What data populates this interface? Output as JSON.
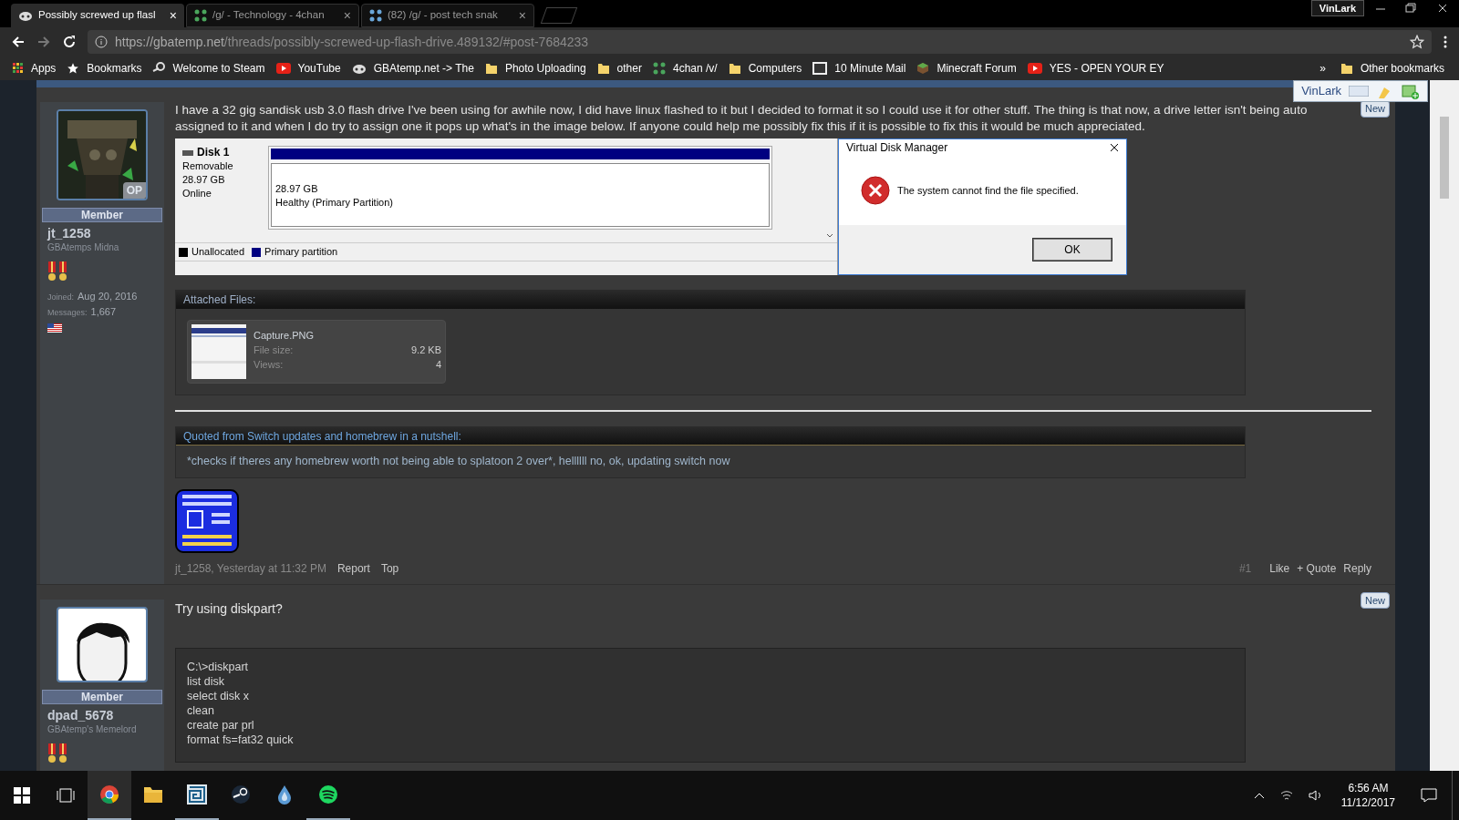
{
  "browser": {
    "tabs": [
      {
        "title": "Possibly screwed up flasl",
        "selected": true,
        "close": "×"
      },
      {
        "title": "/g/ - Technology - 4chan",
        "selected": false,
        "close": "×"
      },
      {
        "title": "(82) /g/ - post tech snak",
        "selected": false,
        "close": "×"
      }
    ],
    "profile": "VinLark",
    "url_host": "https://gbatemp.net",
    "url_path": "/threads/possibly-screwed-up-flash-drive.489132/#post-7684233",
    "bookmarks": [
      {
        "label": "Apps",
        "kind": "apps"
      },
      {
        "label": "Bookmarks",
        "kind": "star"
      },
      {
        "label": "Welcome to Steam",
        "kind": "steam"
      },
      {
        "label": "YouTube",
        "kind": "youtube"
      },
      {
        "label": "GBAtemp.net -> The",
        "kind": "gba"
      },
      {
        "label": "Photo Uploading",
        "kind": "folder"
      },
      {
        "label": "other",
        "kind": "folder"
      },
      {
        "label": "4chan /v/",
        "kind": "clover"
      },
      {
        "label": "Computers",
        "kind": "folder"
      },
      {
        "label": "10 Minute Mail",
        "kind": "ten"
      },
      {
        "label": "Minecraft Forum",
        "kind": "cube"
      },
      {
        "label": "YES - OPEN YOUR EY",
        "kind": "youtube"
      }
    ],
    "overflow": "»",
    "other_bookmarks": "Other bookmarks"
  },
  "extension": {
    "label": "VinLark"
  },
  "posts": [
    {
      "user": {
        "name": "jt_1258",
        "title": "GBAtemps Midna",
        "rank": "Member",
        "badge": "OP",
        "joined_label": "Joined:",
        "joined": "Aug 20, 2016",
        "messages_label": "Messages:",
        "messages": "1,667"
      },
      "new_badge": "New",
      "text": "I have a 32 gig sandisk usb 3.0 flash drive I've been using for awhile now, I did have linux flashed to it but I decided to format it so I could use it for other stuff. The thing is that now, a drive letter isn't being auto assigned to it and when I do try to assign one it pops up what's in the image below. If anyone could help me possibly fix this if it is possible to fix this it would be much appreciated.",
      "screenshot": {
        "disk_name": "Disk 1",
        "disk_info": [
          "Removable",
          "28.97 GB",
          "Online"
        ],
        "partition_size": "28.97 GB",
        "partition_status": "Healthy (Primary Partition)",
        "legend": [
          {
            "label": "Unallocated",
            "color": "#000000"
          },
          {
            "label": "Primary partition",
            "color": "#000080"
          }
        ],
        "dialog": {
          "title": "Virtual Disk Manager",
          "message": "The system cannot find the file specified.",
          "button": "OK"
        }
      },
      "attachments": {
        "title": "Attached Files:",
        "files": [
          {
            "name": "Capture.PNG",
            "size_label": "File size:",
            "size": "9.2 KB",
            "views_label": "Views:",
            "views": "4"
          }
        ]
      },
      "quote": {
        "source": "Quoted from Switch updates and homebrew in a nutshell:",
        "text": "*checks if theres any homebrew worth not being able to splatoon 2 over*, hellllll no, ok, updating switch now"
      },
      "footer": {
        "author": "jt_1258, Yesterday at 11:32 PM",
        "links": [
          "Report",
          "Top"
        ],
        "number": "#1",
        "actions": [
          "Like",
          "+ Quote",
          "Reply"
        ]
      }
    },
    {
      "user": {
        "name": "dpad_5678",
        "title": "GBAtemp's Memelord",
        "rank": "Member"
      },
      "new_badge": "New",
      "text": "Try using diskpart?",
      "code": [
        "C:\\>diskpart",
        "list disk",
        "select disk x",
        "clean",
        "create par prl",
        "format fs=fat32 quick"
      ]
    }
  ],
  "taskbar": {
    "apps": [
      {
        "kind": "chrome",
        "active": true
      },
      {
        "kind": "files",
        "active": false
      },
      {
        "kind": "maze",
        "active": true
      },
      {
        "kind": "steam",
        "active": false
      },
      {
        "kind": "drop",
        "active": false
      },
      {
        "kind": "spotify",
        "active": true
      }
    ],
    "time": "6:56 AM",
    "date": "11/12/2017"
  }
}
